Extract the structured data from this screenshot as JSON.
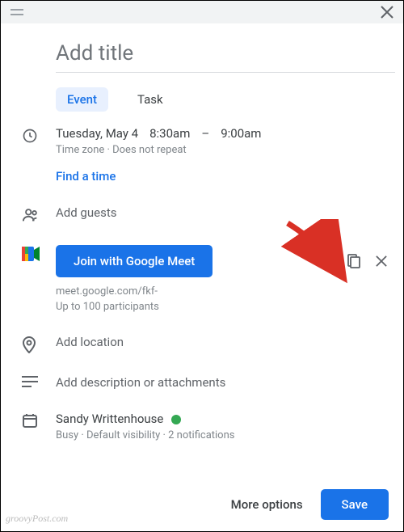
{
  "title": {
    "placeholder": "Add title"
  },
  "tabs": {
    "event": "Event",
    "task": "Task"
  },
  "datetime": {
    "date": "Tuesday, May 4",
    "start": "8:30am",
    "sep": "–",
    "end": "9:00am",
    "sub": "Time zone · Does not repeat",
    "find": "Find a time"
  },
  "guests": {
    "placeholder": "Add guests"
  },
  "meet": {
    "button": "Join with Google Meet",
    "link": "meet.google.com/fkf-",
    "limit": "Up to 100 participants"
  },
  "location": {
    "placeholder": "Add location"
  },
  "description": {
    "placeholder": "Add description or attachments"
  },
  "organizer": {
    "name": "Sandy Writtenhouse",
    "sub": "Busy · Default visibility · 2 notifications"
  },
  "footer": {
    "more": "More options",
    "save": "Save"
  },
  "watermark": "groovyPost.com"
}
